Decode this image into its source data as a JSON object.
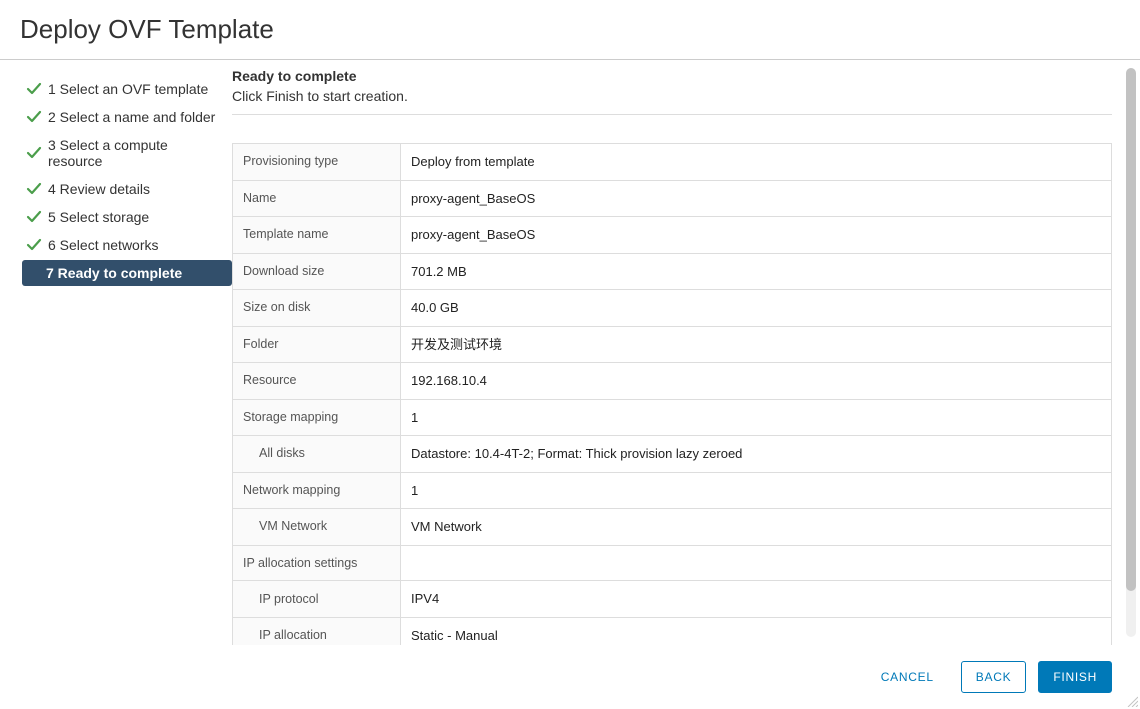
{
  "dialog": {
    "title": "Deploy OVF Template"
  },
  "steps": [
    {
      "label": "1 Select an OVF template",
      "done": true,
      "active": false
    },
    {
      "label": "2 Select a name and folder",
      "done": true,
      "active": false
    },
    {
      "label": "3 Select a compute resource",
      "done": true,
      "active": false
    },
    {
      "label": "4 Review details",
      "done": true,
      "active": false
    },
    {
      "label": "5 Select storage",
      "done": true,
      "active": false
    },
    {
      "label": "6 Select networks",
      "done": true,
      "active": false
    },
    {
      "label": "7 Ready to complete",
      "done": false,
      "active": true
    }
  ],
  "section": {
    "title": "Ready to complete",
    "subtitle": "Click Finish to start creation."
  },
  "summary": [
    {
      "key": "Provisioning type",
      "value": "Deploy from template"
    },
    {
      "key": "Name",
      "value": "proxy-agent_BaseOS"
    },
    {
      "key": "Template name",
      "value": "proxy-agent_BaseOS"
    },
    {
      "key": "Download size",
      "value": "701.2 MB"
    },
    {
      "key": "Size on disk",
      "value": "40.0 GB"
    },
    {
      "key": "Folder",
      "value": "开发及测试环境"
    },
    {
      "key": "Resource",
      "value": "192.168.10.4"
    },
    {
      "key": "Storage mapping",
      "value": "1"
    },
    {
      "key": "All disks",
      "value": "Datastore: 10.4-4T-2; Format: Thick provision lazy zeroed",
      "indent": true
    },
    {
      "key": "Network mapping",
      "value": "1"
    },
    {
      "key": "VM Network",
      "value": "VM Network",
      "indent": true
    },
    {
      "key": "IP allocation settings",
      "value": ""
    },
    {
      "key": "IP protocol",
      "value": "IPV4",
      "indent": true
    },
    {
      "key": "IP allocation",
      "value": "Static - Manual",
      "indent": true
    }
  ],
  "buttons": {
    "cancel": "CANCEL",
    "back": "BACK",
    "finish": "FINISH"
  }
}
